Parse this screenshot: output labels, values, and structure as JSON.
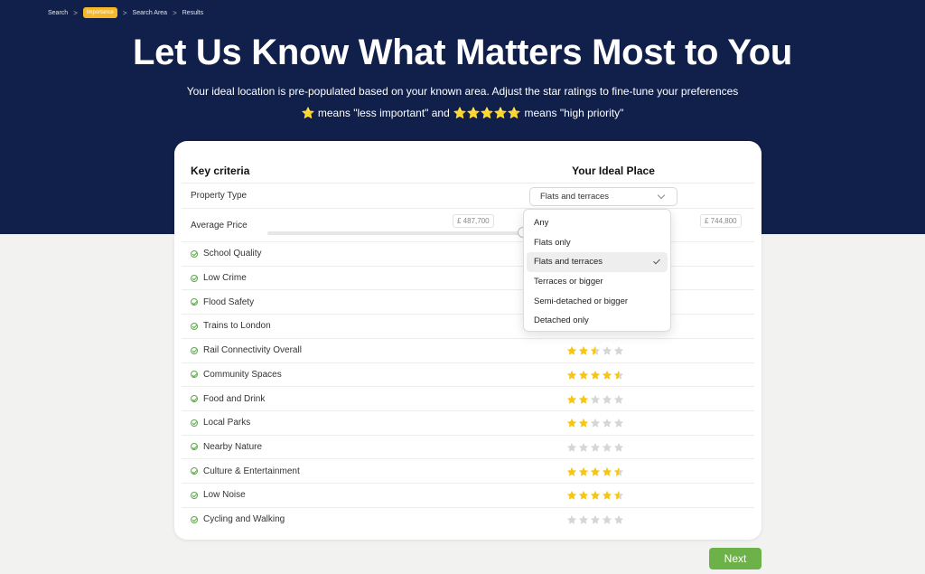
{
  "breadcrumb": {
    "items": [
      "Search",
      "Importance",
      "Search Area",
      "Results"
    ],
    "separator": ">"
  },
  "hero": {
    "title": "Let Us Know What Matters Most to You",
    "subtitle": "Your ideal location is pre-populated based on your known area. Adjust the star ratings to fine-tune your preferences",
    "legend_prefix": "⭐ means \"less important\" and",
    "legend_stars": "⭐⭐⭐⭐⭐",
    "legend_suffix": "means \"high priority\""
  },
  "table": {
    "header_left": "Key criteria",
    "header_right": "Your Ideal Place",
    "property_type_label": "Property Type",
    "property_type_value": "Flats and terraces",
    "average_price_label": "Average Price",
    "price_min": "£ 487,700",
    "price_max": "£ 744,800",
    "criteria": [
      {
        "label": "School Quality",
        "rating": null
      },
      {
        "label": "Low Crime",
        "rating": null
      },
      {
        "label": "Flood Safety",
        "rating": null
      },
      {
        "label": "Trains to London",
        "rating": null
      },
      {
        "label": "Rail Connectivity Overall",
        "rating": 2.5
      },
      {
        "label": "Community Spaces",
        "rating": 4.5
      },
      {
        "label": "Food and Drink",
        "rating": 2
      },
      {
        "label": "Local Parks",
        "rating": 2
      },
      {
        "label": "Nearby Nature",
        "rating": 0
      },
      {
        "label": "Culture & Entertainment",
        "rating": 4.5
      },
      {
        "label": "Low Noise",
        "rating": 4.5
      },
      {
        "label": "Cycling and Walking",
        "rating": 0
      }
    ]
  },
  "dropdown": {
    "options": [
      "Any",
      "Flats only",
      "Flats and terraces",
      "Terraces or bigger",
      "Semi-detached or bigger",
      "Detached only"
    ],
    "selected": "Flats and terraces"
  },
  "footer": {
    "next_label": "Next"
  },
  "colors": {
    "hero_bg": "#10204a",
    "accent_green": "#6db248",
    "star_gold": "#f5c518",
    "star_empty": "#d6d6d6",
    "crumb_active": "#f5b82a"
  }
}
